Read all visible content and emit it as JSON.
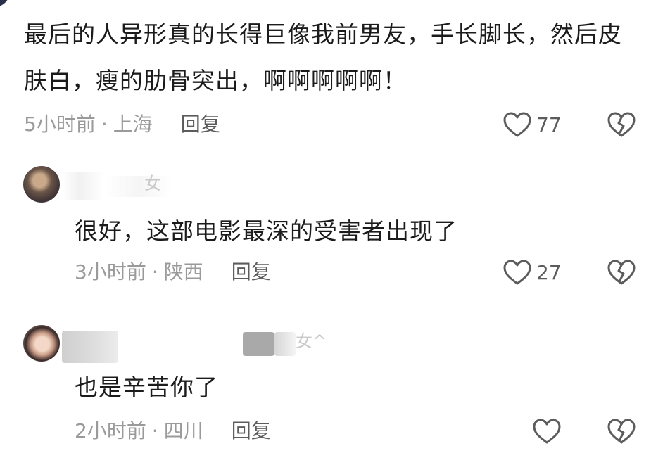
{
  "comments": [
    {
      "text": "最后的人异形真的长得巨像我前男友，手长脚长，然后皮肤白，瘦的肋骨突出，啊啊啊啊啊！",
      "time": "5小时前",
      "location": "上海",
      "reply_label": "回复",
      "likes": "77"
    },
    {
      "username_fragment": "女",
      "text": "很好，这部电影最深的受害者出现了",
      "time": "3小时前",
      "location": "陕西",
      "reply_label": "回复",
      "likes": "27"
    },
    {
      "username_fragment": "女^",
      "text": "也是辛苦你了",
      "time": "2小时前",
      "location": "四川",
      "reply_label": "回复",
      "likes": ""
    }
  ],
  "separator": "·",
  "icons": {
    "like": "heart-outline-icon",
    "dislike": "broken-heart-icon"
  },
  "colors": {
    "text": "#1b1b1b",
    "meta": "#9a9a9a",
    "icon": "#5c5c5c"
  }
}
